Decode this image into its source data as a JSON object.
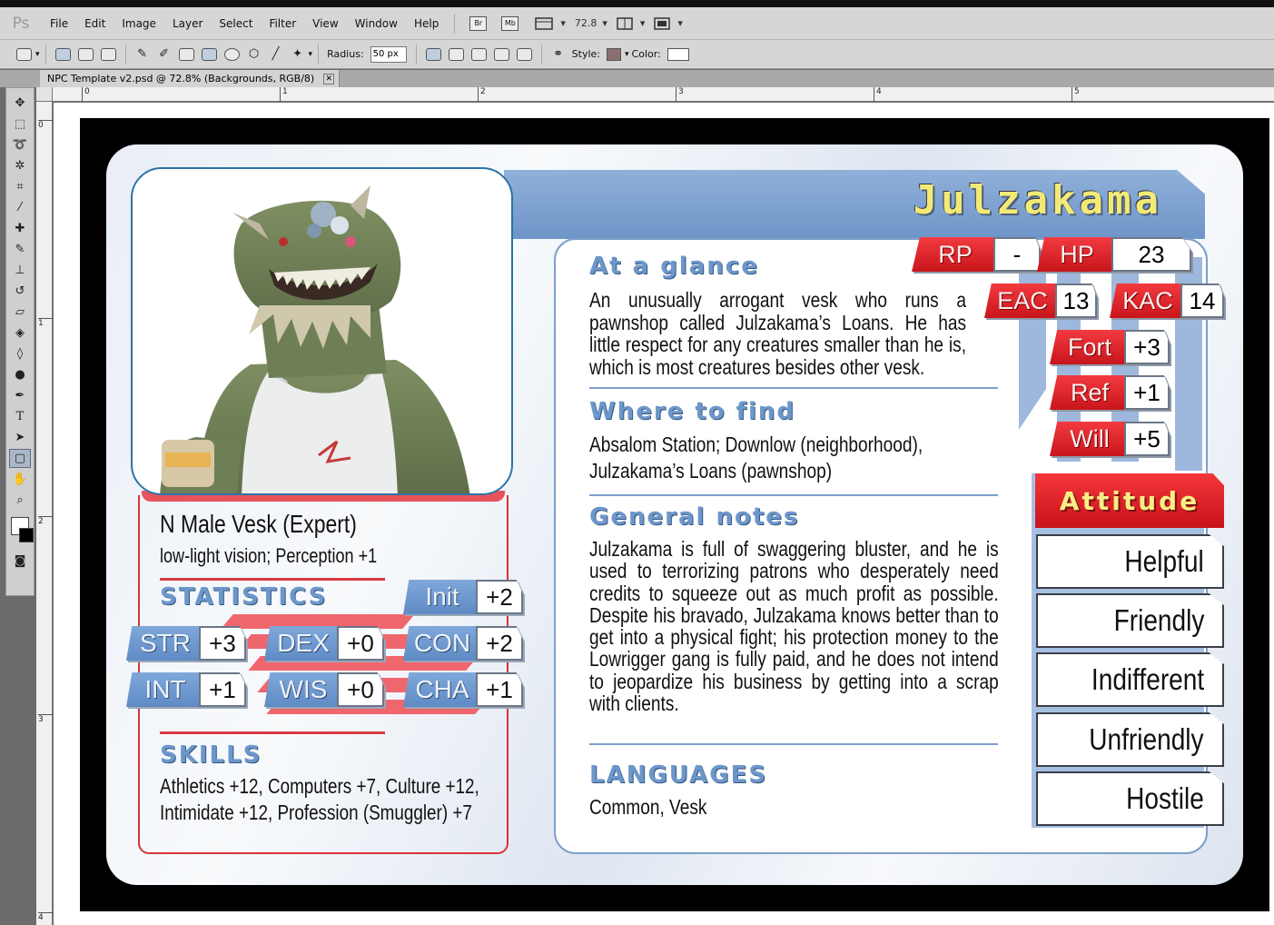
{
  "window": {
    "app_logo": "Ps",
    "menu": [
      "File",
      "Edit",
      "Image",
      "Layer",
      "Select",
      "Filter",
      "View",
      "Window",
      "Help"
    ],
    "bridge_label": "Br",
    "minibridge_label": "Mb",
    "zoom_value": "72.8",
    "document_tab": "NPC Template v2.psd @ 72.8% (Backgrounds, RGB/8)",
    "tab_close": "✕"
  },
  "options_bar": {
    "radius_label": "Radius:",
    "radius_value": "50 px",
    "style_label": "Style:",
    "color_label": "Color:",
    "style_color": "#8a6f70",
    "fill_color": "#ffffff"
  },
  "rulers": {
    "horizontal": [
      "0",
      "1",
      "2",
      "3",
      "4",
      "5"
    ],
    "vertical": [
      "0",
      "1",
      "2",
      "3",
      "4"
    ]
  },
  "card": {
    "name": "Julzakama",
    "race_line": "N Male Vesk (Expert)",
    "senses": "low-light vision; Perception +1",
    "statistics_title": "STATISTICS",
    "init": {
      "label": "Init",
      "value": "+2"
    },
    "abilities": [
      {
        "label": "STR",
        "value": "+3"
      },
      {
        "label": "DEX",
        "value": "+0"
      },
      {
        "label": "CON",
        "value": "+2"
      },
      {
        "label": "INT",
        "value": "+1"
      },
      {
        "label": "WIS",
        "value": "+0"
      },
      {
        "label": "CHA",
        "value": "+1"
      }
    ],
    "skills_title": "SKILLS",
    "skills_line1": "Athletics +12, Computers +7, Culture +12,",
    "skills_line2": "Intimidate +12, Profession (Smuggler) +7",
    "glance_title": "At a glance",
    "glance_text": "An unusually arrogant vesk who runs a pawnshop called Julzakama’s Loans. He has little respect for any creatures smaller than he is, which is most creatures besides other vesk.",
    "where_title": "Where to find",
    "where_line1": "Absalom Station; Downlow (neighborhood),",
    "where_line2": "Julzakama’s Loans (pawnshop)",
    "notes_title": "General notes",
    "notes_text": "Julzakama is full of swaggering bluster, and he is used to terrorizing patrons who desperately need credits to squeeze out as much profit as possible. Despite his bravado, Julzakama knows better than to get into a physical fight; his protection money to the Lowrigger gang is fully paid, and he does not intend to jeopardize his business by getting into a scrap with clients.",
    "languages_title": "LANGUAGES",
    "languages": "Common, Vesk",
    "defenses": {
      "rp": {
        "label": "RP",
        "value": "-"
      },
      "hp": {
        "label": "HP",
        "value": "23"
      },
      "eac": {
        "label": "EAC",
        "value": "13"
      },
      "kac": {
        "label": "KAC",
        "value": "14"
      },
      "fort": {
        "label": "Fort",
        "value": "+3"
      },
      "ref": {
        "label": "Ref",
        "value": "+1"
      },
      "will": {
        "label": "Will",
        "value": "+5"
      }
    },
    "attitude_title": "Attitude",
    "attitudes": [
      "Helpful",
      "Friendly",
      "Indifferent",
      "Unfriendly",
      "Hostile"
    ],
    "colors": {
      "accent_red": "#e0222a",
      "accent_blue": "#6d97cb",
      "name_yellow": "#f3ea76"
    }
  }
}
